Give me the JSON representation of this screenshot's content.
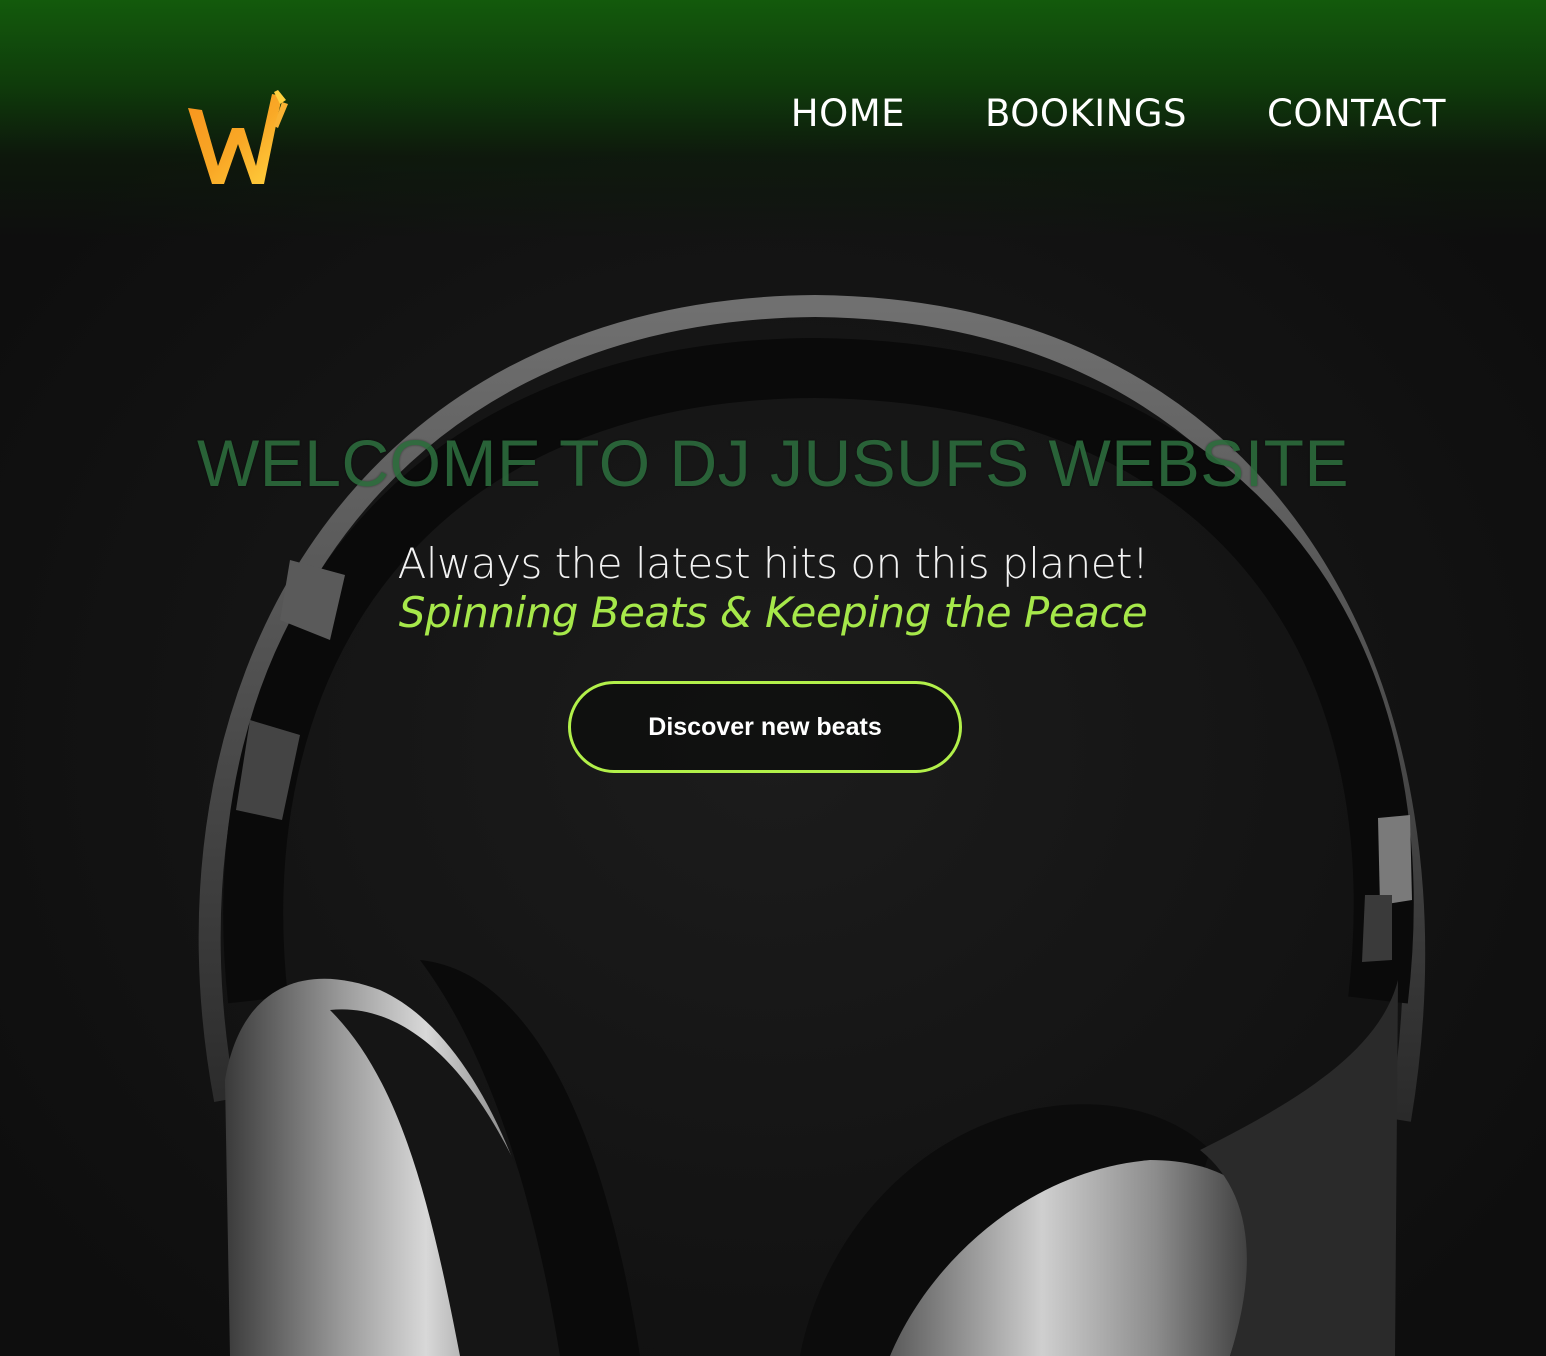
{
  "header": {
    "logo_icon": "stylized-w-logo",
    "nav": [
      {
        "label": "HOME"
      },
      {
        "label": "BOOKINGS"
      },
      {
        "label": "CONTACT"
      }
    ]
  },
  "hero": {
    "title": "WELCOME TO DJ JUSUFS WEBSITE",
    "tagline": "Always the latest hits on this planet!",
    "sub_tagline": "Spinning Beats & Keeping the Peace",
    "cta_label": "Discover new beats",
    "background_image": "headphones-photo"
  },
  "colors": {
    "top_gradient": "#135a0c",
    "title": "#2c6b3c",
    "accent": "#a6e84a",
    "button_border": "#b2f04a",
    "logo_orange": "#f7941d",
    "logo_yellow": "#ffd23f"
  }
}
